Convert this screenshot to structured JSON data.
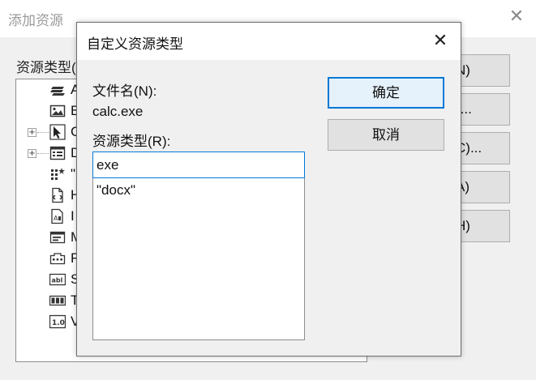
{
  "background_window": {
    "title": "添加资源",
    "close_glyph": "✕",
    "resource_type_label": "资源类型(",
    "tree_items": [
      {
        "label": "A",
        "icon": "accelerator-icon",
        "expandable": false
      },
      {
        "label": "B",
        "icon": "bitmap-icon",
        "expandable": false
      },
      {
        "label": "C",
        "icon": "cursor-icon",
        "expandable": true
      },
      {
        "label": "D",
        "icon": "dialog-icon",
        "expandable": true
      },
      {
        "label": "\"",
        "icon": "custom-resource-icon",
        "expandable": false
      },
      {
        "label": "H",
        "icon": "html-icon",
        "expandable": false
      },
      {
        "label": "I",
        "icon": "icon-resource-icon",
        "expandable": false
      },
      {
        "label": "M",
        "icon": "menu-icon",
        "expandable": false
      },
      {
        "label": "R",
        "icon": "ribbon-icon",
        "expandable": false
      },
      {
        "label": "S",
        "icon": "string-table-icon",
        "expandable": false
      },
      {
        "label": "T",
        "icon": "toolbar-icon",
        "expandable": false
      },
      {
        "label": "V",
        "icon": "version-icon",
        "expandable": false
      }
    ],
    "buttons": [
      "N)",
      ")...",
      "C)...",
      "A)",
      "H)"
    ]
  },
  "dialog": {
    "title": "自定义资源类型",
    "close_glyph": "✕",
    "file_name_label": "文件名(N):",
    "file_name_value": "calc.exe",
    "resource_type_label": "资源类型(R):",
    "resource_type_value": "exe",
    "resource_type_options": [
      "\"docx\""
    ],
    "ok_label": "确定",
    "cancel_label": "取消"
  },
  "colors": {
    "accent": "#0078d7",
    "dialog_bg": "#f0f0f0",
    "button_bg": "#e1e1e1"
  }
}
